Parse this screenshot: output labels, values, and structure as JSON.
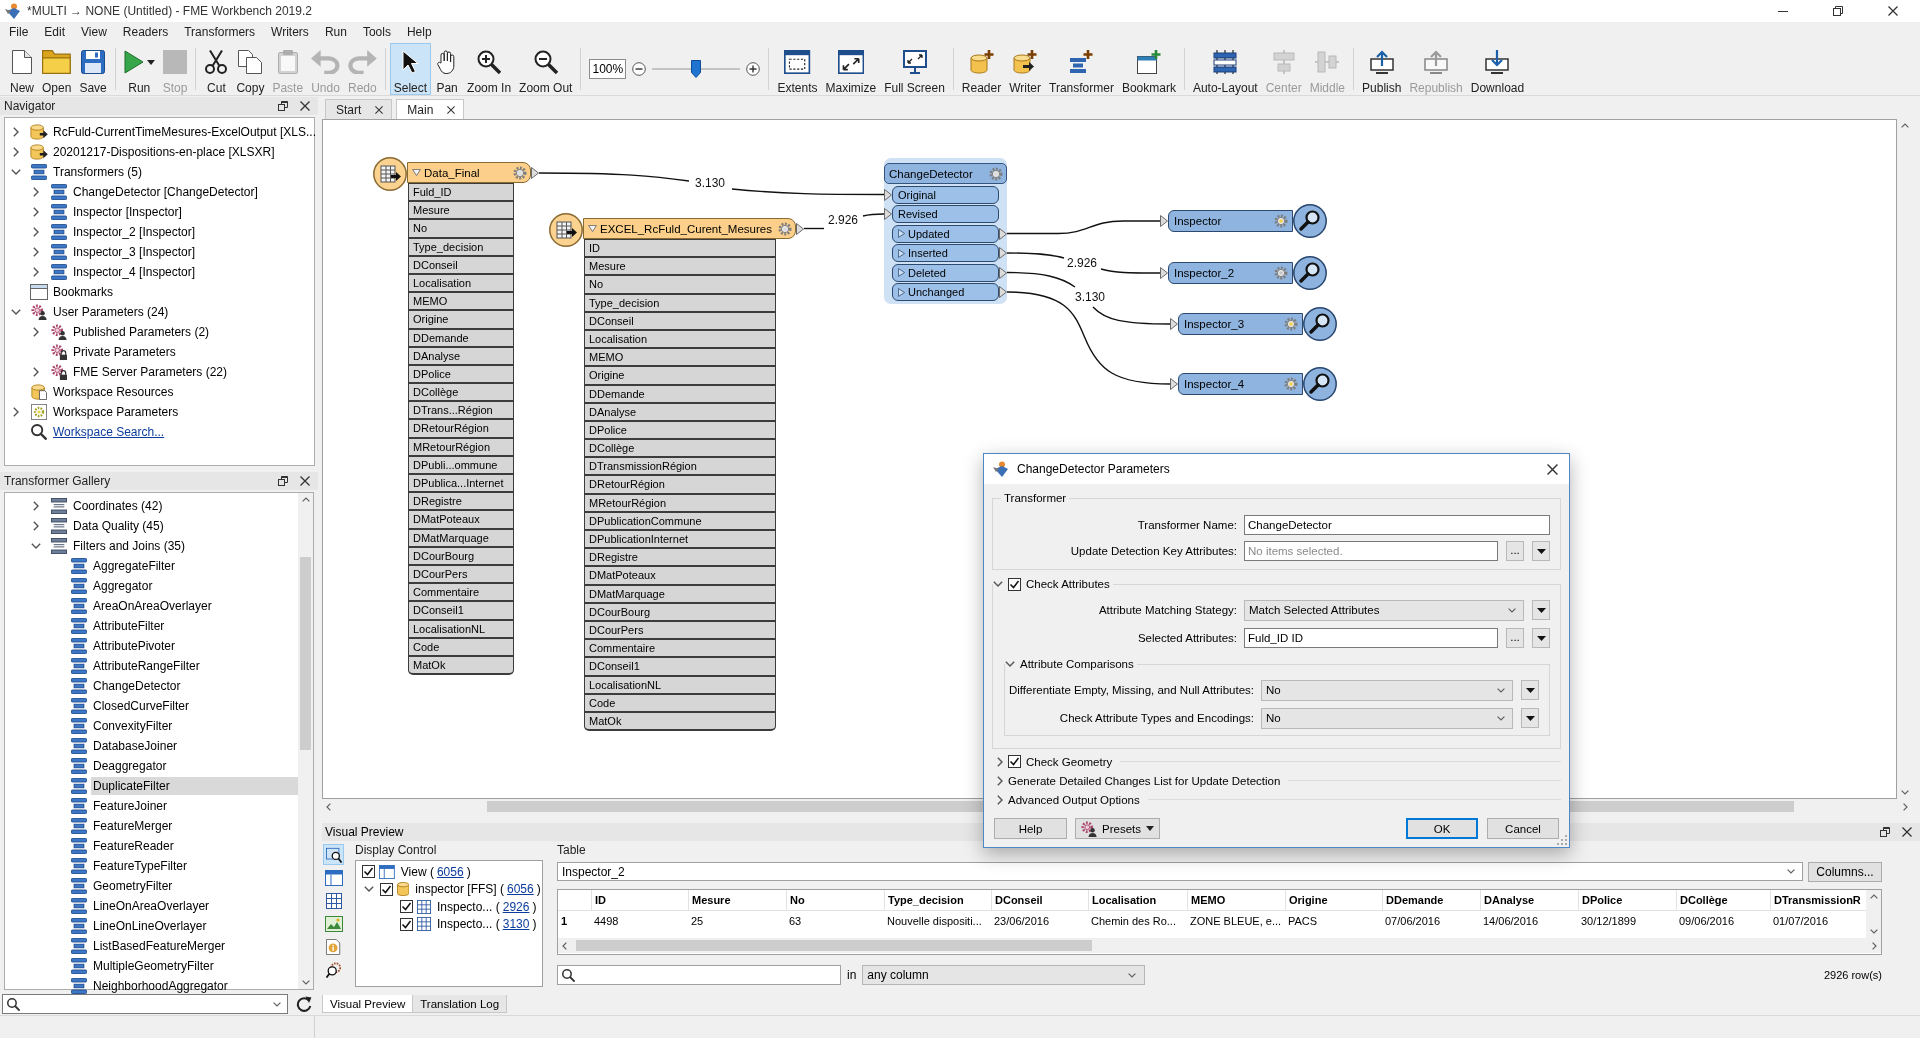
{
  "window": {
    "title": "*MULTI → NONE (Untitled) - FME Workbench 2019.2"
  },
  "menu": [
    "File",
    "Edit",
    "View",
    "Readers",
    "Transformers",
    "Writers",
    "Run",
    "Tools",
    "Help"
  ],
  "toolbar": [
    {
      "kind": "buttons",
      "items": [
        {
          "label": "New",
          "disabled": false,
          "selected": false
        },
        {
          "label": "Open",
          "disabled": false,
          "selected": false
        },
        {
          "label": "Save",
          "disabled": false,
          "selected": false
        }
      ]
    },
    {
      "kind": "buttons",
      "items": [
        {
          "label": "Run",
          "disabled": false,
          "selected": false,
          "dropdown": true
        },
        {
          "label": "Stop",
          "disabled": true,
          "selected": false
        }
      ]
    },
    {
      "kind": "buttons",
      "items": [
        {
          "label": "Cut",
          "disabled": false,
          "selected": false
        },
        {
          "label": "Copy",
          "disabled": false,
          "selected": false
        },
        {
          "label": "Paste",
          "disabled": true,
          "selected": false
        },
        {
          "label": "Undo",
          "disabled": true,
          "selected": false
        },
        {
          "label": "Redo",
          "disabled": true,
          "selected": false
        }
      ]
    },
    {
      "kind": "buttons",
      "items": [
        {
          "label": "Select",
          "disabled": false,
          "selected": true
        },
        {
          "label": "Pan",
          "disabled": false,
          "selected": false
        },
        {
          "label": "Zoom In",
          "disabled": false,
          "selected": false
        },
        {
          "label": "Zoom Out",
          "disabled": false,
          "selected": false
        }
      ]
    },
    {
      "kind": "zoom",
      "value": "100%",
      "level": 0.5
    },
    {
      "kind": "buttons",
      "items": [
        {
          "label": "Extents",
          "disabled": false,
          "selected": false
        },
        {
          "label": "Maximize",
          "disabled": false,
          "selected": false
        },
        {
          "label": "Full Screen",
          "disabled": false,
          "selected": false
        }
      ]
    },
    {
      "kind": "buttons",
      "items": [
        {
          "label": "Reader",
          "disabled": false,
          "selected": false
        },
        {
          "label": "Writer",
          "disabled": false,
          "selected": false
        },
        {
          "label": "Transformer",
          "disabled": false,
          "selected": false
        },
        {
          "label": "Bookmark",
          "disabled": false,
          "selected": false
        }
      ]
    },
    {
      "kind": "buttons",
      "items": [
        {
          "label": "Auto-Layout",
          "disabled": false,
          "selected": false
        },
        {
          "label": "Center",
          "disabled": true,
          "selected": false
        },
        {
          "label": "Middle",
          "disabled": true,
          "selected": false
        }
      ]
    },
    {
      "kind": "buttons",
      "items": [
        {
          "label": "Publish",
          "disabled": false,
          "selected": false
        },
        {
          "label": "Republish",
          "disabled": true,
          "selected": false
        },
        {
          "label": "Download",
          "disabled": false,
          "selected": false
        }
      ]
    }
  ],
  "navigator": {
    "title": "Navigator",
    "items": [
      {
        "label": "RcFuld-CurrentTimeMesures-ExcelOutput [XLS...",
        "kind": "writer",
        "expanded": false
      },
      {
        "label": "20201217-Dispositions-en-place [XLSXR]",
        "kind": "reader",
        "expanded": false
      },
      {
        "label": "Transformers (5)",
        "kind": "transformer",
        "expanded": true,
        "children": [
          {
            "label": "ChangeDetector [ChangeDetector]",
            "kind": "transformer",
            "expanded": false
          },
          {
            "label": "Inspector [Inspector]",
            "kind": "transformer",
            "expanded": false
          },
          {
            "label": "Inspector_2 [Inspector]",
            "kind": "transformer",
            "expanded": false
          },
          {
            "label": "Inspector_3 [Inspector]",
            "kind": "transformer",
            "expanded": false
          },
          {
            "label": "Inspector_4 [Inspector]",
            "kind": "transformer",
            "expanded": false
          }
        ]
      },
      {
        "label": "Bookmarks",
        "kind": "bookmarks"
      },
      {
        "label": "User Parameters (24)",
        "kind": "user-parameters",
        "expanded": true,
        "children": [
          {
            "label": "Published Parameters (2)",
            "kind": "published-parameters",
            "expanded": false
          },
          {
            "label": "Private Parameters",
            "kind": "private-parameters"
          },
          {
            "label": "FME Server Parameters (22)",
            "kind": "server-parameters",
            "expanded": false
          }
        ]
      },
      {
        "label": "Workspace Resources",
        "kind": "resources"
      },
      {
        "label": "Workspace Parameters",
        "kind": "workspace-parameters",
        "expanded": false
      },
      {
        "label": "Workspace Search...",
        "kind": "search"
      }
    ]
  },
  "gallery": {
    "title": "Transformer Gallery",
    "items": [
      {
        "label": "Coordinates (42)",
        "kind": "category",
        "expanded": false,
        "selected": false
      },
      {
        "label": "Data Quality (45)",
        "kind": "category",
        "expanded": false,
        "selected": false
      },
      {
        "label": "Filters and Joins (35)",
        "kind": "category",
        "expanded": true,
        "selected": false,
        "children": [
          {
            "label": "AggregateFilter",
            "kind": "transformer",
            "selected": false
          },
          {
            "label": "Aggregator",
            "kind": "transformer",
            "selected": false
          },
          {
            "label": "AreaOnAreaOverlayer",
            "kind": "transformer",
            "selected": false
          },
          {
            "label": "AttributeFilter",
            "kind": "transformer",
            "selected": false
          },
          {
            "label": "AttributePivoter",
            "kind": "transformer",
            "selected": false
          },
          {
            "label": "AttributeRangeFilter",
            "kind": "transformer",
            "selected": false
          },
          {
            "label": "ChangeDetector",
            "kind": "transformer",
            "selected": false
          },
          {
            "label": "ClosedCurveFilter",
            "kind": "transformer",
            "selected": false
          },
          {
            "label": "ConvexityFilter",
            "kind": "transformer",
            "selected": false
          },
          {
            "label": "DatabaseJoiner",
            "kind": "transformer",
            "selected": false
          },
          {
            "label": "Deaggregator",
            "kind": "transformer",
            "selected": false
          },
          {
            "label": "DuplicateFilter",
            "kind": "transformer",
            "selected": true
          },
          {
            "label": "FeatureJoiner",
            "kind": "transformer",
            "selected": false
          },
          {
            "label": "FeatureMerger",
            "kind": "transformer",
            "selected": false
          },
          {
            "label": "FeatureReader",
            "kind": "transformer",
            "selected": false
          },
          {
            "label": "FeatureTypeFilter",
            "kind": "transformer",
            "selected": false
          },
          {
            "label": "GeometryFilter",
            "kind": "transformer",
            "selected": false
          },
          {
            "label": "LineOnAreaOverlayer",
            "kind": "transformer",
            "selected": false
          },
          {
            "label": "LineOnLineOverlayer",
            "kind": "transformer",
            "selected": false
          },
          {
            "label": "ListBasedFeatureMerger",
            "kind": "transformer",
            "selected": false
          },
          {
            "label": "MultipleGeometryFilter",
            "kind": "transformer",
            "selected": false
          },
          {
            "label": "NeighborhoodAggregator",
            "kind": "transformer",
            "selected": false
          }
        ]
      }
    ]
  },
  "canvas_tabs": [
    {
      "label": "Start",
      "selected": false
    },
    {
      "label": "Main",
      "selected": true
    }
  ],
  "canvas": {
    "nodes": [
      {
        "kind": "reader",
        "name": "Data_Final",
        "selected": false,
        "expanded": true,
        "attributes": [
          "Fuld_ID",
          "Mesure",
          "No",
          "Type_decision",
          "DConseil",
          "Localisation",
          "MEMO",
          "Origine",
          "DDemande",
          "DAnalyse",
          "DPolice",
          "DCollège",
          "DTrans...Région",
          "DRetourRégion",
          "MRetourRégion",
          "DPubli...ommune",
          "DPublica...Internet",
          "DRegistre",
          "DMatPoteaux",
          "DMatMarquage",
          "DCourBourg",
          "DCourPers",
          "Commentaire",
          "DConseil1",
          "LocalisationNL",
          "Code",
          "MatOk"
        ]
      },
      {
        "kind": "reader",
        "name": "EXCEL_RcFuld_Curent_Mesures",
        "selected": false,
        "expanded": true,
        "attributes": [
          "ID",
          "Mesure",
          "No",
          "Type_decision",
          "DConseil",
          "Localisation",
          "MEMO",
          "Origine",
          "DDemande",
          "DAnalyse",
          "DPolice",
          "DCollège",
          "DTransmissionRégion",
          "DRetourRégion",
          "MRetourRégion",
          "DPublicationCommune",
          "DPublicationInternet",
          "DRegistre",
          "DMatPoteaux",
          "DMatMarquage",
          "DCourBourg",
          "DCourPers",
          "Commentaire",
          "DConseil1",
          "LocalisationNL",
          "Code",
          "MatOk"
        ]
      },
      {
        "kind": "transformer",
        "name": "ChangeDetector",
        "selected": true,
        "ports": [
          {
            "kind": "input",
            "label": "Original"
          },
          {
            "kind": "input",
            "label": "Revised"
          },
          {
            "kind": "output",
            "label": "Updated",
            "expanded": false
          },
          {
            "kind": "output",
            "label": "Inserted",
            "expanded": false
          },
          {
            "kind": "output",
            "label": "Deleted",
            "expanded": false
          },
          {
            "kind": "output",
            "label": "Unchanged",
            "expanded": false
          }
        ]
      },
      {
        "kind": "inspector",
        "name": "Inspector",
        "selected": false,
        "gear_lit": true
      },
      {
        "kind": "inspector",
        "name": "Inspector_2",
        "selected": false,
        "gear_lit": false
      },
      {
        "kind": "inspector",
        "name": "Inspector_3",
        "selected": false,
        "gear_lit": true
      },
      {
        "kind": "inspector",
        "name": "Inspector_4",
        "selected": false,
        "gear_lit": true
      }
    ],
    "connections": [
      {
        "count": "3.130"
      },
      {
        "count": "2.926"
      },
      {
        "count": "2.926"
      },
      {
        "count": "3.130"
      }
    ]
  },
  "dialog": {
    "title": "ChangeDetector Parameters",
    "transformer": {
      "legend": "Transformer",
      "fields": [
        {
          "kind": "text",
          "label": "Transformer Name:",
          "value": "ChangeDetector"
        },
        {
          "kind": "picker",
          "label": "Update Detection Key Attributes:",
          "placeholder": "No items selected.",
          "browse": "..."
        }
      ]
    },
    "check_attributes": {
      "label": "Check Attributes",
      "expanded": true,
      "checked": true,
      "fields": [
        {
          "kind": "combo",
          "label": "Attribute Matching Stategy:",
          "value": "Match Selected Attributes"
        },
        {
          "kind": "picker",
          "label": "Selected Attributes:",
          "value": "Fuld_ID ID",
          "browse": "..."
        }
      ],
      "comparisons": {
        "label": "Attribute Comparisons",
        "expanded": true,
        "fields": [
          {
            "kind": "combo",
            "label": "Differentiate Empty, Missing, and Null Attributes:",
            "value": "No"
          },
          {
            "kind": "combo",
            "label": "Check Attribute Types and Encodings:",
            "value": "No"
          }
        ]
      }
    },
    "sections": [
      {
        "label": "Check Geometry",
        "expanded": false,
        "checked": true
      },
      {
        "label": "Generate Detailed Changes List for Update Detection",
        "expanded": false
      },
      {
        "label": "Advanced Output Options",
        "expanded": false
      }
    ],
    "buttons": [
      {
        "kind": "plain",
        "label": "Help"
      },
      {
        "kind": "menu",
        "label": "Presets"
      },
      {
        "kind": "default",
        "label": "OK"
      },
      {
        "kind": "plain",
        "label": "Cancel"
      }
    ]
  },
  "visual_preview": {
    "title": "Visual Preview",
    "tools": [
      {
        "selected": true
      },
      {
        "selected": false
      },
      {
        "selected": false
      },
      {
        "selected": false
      },
      {
        "selected": false
      },
      {
        "selected": false
      }
    ],
    "display_control": {
      "title": "Display Control",
      "items": [
        {
          "kind": "view",
          "label": "View (",
          "count": "6056",
          "close": ")",
          "checked": true
        },
        {
          "kind": "dataset",
          "label": "inspector [FFS] (",
          "count": "6056",
          "close": ")",
          "checked": true,
          "expanded": true,
          "children": [
            {
              "kind": "table",
              "label": "Inspecto... (",
              "count": "2926",
              "close": ")",
              "checked": true
            },
            {
              "kind": "table",
              "label": "Inspecto... (",
              "count": "3130",
              "close": ")",
              "checked": true
            }
          ]
        }
      ]
    },
    "table": {
      "title": "Table",
      "source": "Inspector_2",
      "columns_button": "Columns...",
      "columns": [
        "ID",
        "Mesure",
        "No",
        "Type_decision",
        "DConseil",
        "Localisation",
        "MEMO",
        "Origine",
        "DDemande",
        "DAnalyse",
        "DPolice",
        "DCollège",
        "DTransmissionR"
      ],
      "rows": [
        {
          "number": "1",
          "cells": [
            "4498",
            "25",
            "63",
            "Nouvelle dispositi...",
            "23/06/2016",
            "Chemin des Ro...",
            "ZONE BLEUE, e...",
            "PACS",
            "07/06/2016",
            "14/06/2016",
            "30/12/1899",
            "09/06/2016",
            "01/07/2016"
          ]
        }
      ],
      "search_scope_label": "in",
      "search_scope": "any column",
      "row_count": "2926 row(s)"
    }
  },
  "bottom_tabs": [
    {
      "label": "Visual Preview",
      "selected": true
    },
    {
      "label": "Translation Log",
      "selected": false
    }
  ]
}
